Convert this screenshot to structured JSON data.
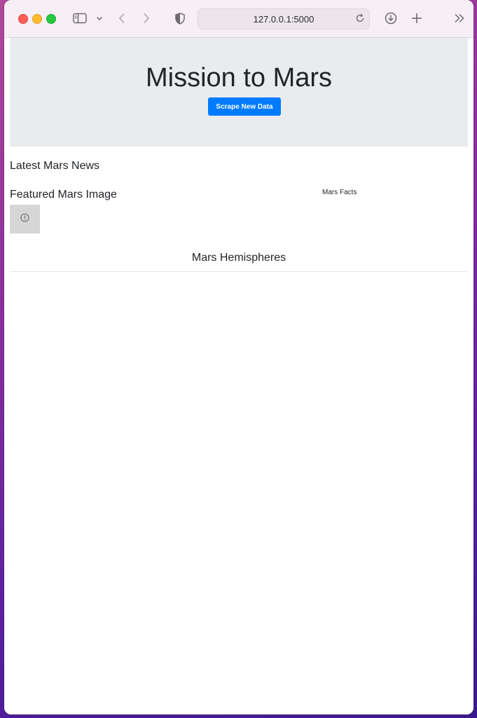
{
  "browser": {
    "url": "127.0.0.1:5000",
    "icons": [
      "sidebar-icon",
      "chevron-down-icon",
      "back-icon",
      "forward-icon",
      "shield-icon",
      "reload-icon",
      "download-icon",
      "plus-icon",
      "chevrons-right-icon"
    ]
  },
  "page": {
    "title": "Mission to Mars",
    "scrape_button": "Scrape New Data",
    "news_heading": "Latest Mars News",
    "featured_heading": "Featured Mars Image",
    "facts_label": "Mars Facts",
    "hemispheres_heading": "Mars Hemispheres"
  },
  "colors": {
    "accent": "#007bff",
    "jumbotron": "#e9ecef",
    "text": "#212529"
  }
}
